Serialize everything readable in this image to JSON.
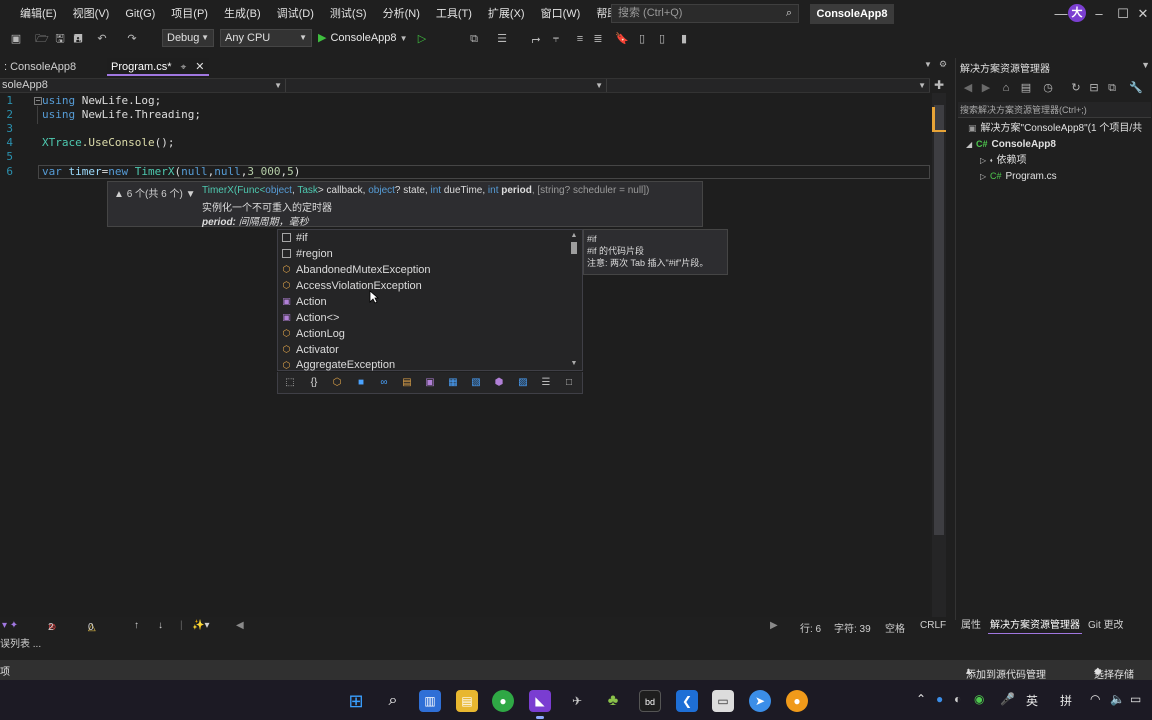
{
  "menu": {
    "items": [
      "编辑(E)",
      "视图(V)",
      "Git(G)",
      "项目(P)",
      "生成(B)",
      "调试(D)",
      "测试(S)",
      "分析(N)",
      "工具(T)",
      "扩展(X)",
      "窗口(W)",
      "帮助(H)"
    ],
    "search_placeholder": "搜索 (Ctrl+Q)",
    "solution_name": "ConsoleApp8",
    "user_initial": "大"
  },
  "toolbar": {
    "config": "Debug",
    "platform": "Any CPU",
    "run_target": "ConsoleApp8"
  },
  "tabs": [
    {
      "label": ": ConsoleApp8"
    },
    {
      "label": "Program.cs*"
    }
  ],
  "navbar": {
    "project": "soleApp8"
  },
  "editor": {
    "line_numbers": [
      "1",
      "2",
      "3",
      "4",
      "5",
      "6"
    ],
    "lines": {
      "l1_kw": "using",
      "l1_ns": " NewLife.Log;",
      "l2_kw": "using",
      "l2_ns": " NewLife.Threading;",
      "l4_type": "XTrace",
      "l4_method": ".UseConsole",
      "l4_rest": "();",
      "l6_var": "var",
      "l6_name": " timer",
      "l6_eq": "=",
      "l6_new": "new",
      "l6_type": " TimerX",
      "l6_args_a": "(",
      "l6_null1": "null",
      "l6_comma1": ",",
      "l6_null2": "null",
      "l6_comma2": ",",
      "l6_num1": "3_000",
      "l6_comma3": ",",
      "l6_num2": "5",
      "l6_close": ")"
    }
  },
  "signature_help": {
    "counter": "6 个(共 6 个)",
    "sig_type": "TimerX",
    "sig_open": "(Func<",
    "sig_object": "object",
    "sig_comma": ", ",
    "sig_task": "Task",
    "sig_close": "> callback, ",
    "sig_object2": "object",
    "sig_state": "? state, ",
    "sig_int": "int",
    "sig_due": " dueTime, ",
    "sig_int2": "int",
    "sig_period": " period",
    "sig_opt": ", [string? scheduler = null])",
    "description": "实例化一个不可重入的定时器",
    "param_name": "period:",
    "param_desc": " 间隔周期，毫秒"
  },
  "completion": {
    "items": [
      {
        "label": "#if",
        "icon": "snippet-icon"
      },
      {
        "label": "#region",
        "icon": "snippet-icon"
      },
      {
        "label": "AbandonedMutexException",
        "icon": "class-icon"
      },
      {
        "label": "AccessViolationException",
        "icon": "class-icon"
      },
      {
        "label": "Action",
        "icon": "delegate-icon"
      },
      {
        "label": "Action<>",
        "icon": "delegate-icon"
      },
      {
        "label": "ActionLog",
        "icon": "class-icon"
      },
      {
        "label": "Activator",
        "icon": "class-icon"
      },
      {
        "label": "AggregateException",
        "icon": "class-icon"
      }
    ],
    "tooltip": {
      "title": "#if",
      "desc": "#if 的代码片段",
      "note": "注意: 两次 Tab 插入\"#if\"片段。"
    }
  },
  "solution_explorer": {
    "title": "解决方案资源管理器",
    "search_placeholder": "搜索解决方案资源管理器(Ctrl+;)",
    "solution_row": "解决方案\"ConsoleApp8\"(1 个项目/共",
    "project_row": "ConsoleApp8",
    "deps_row": "依赖项",
    "file_row": "Program.cs"
  },
  "bottom_tabs": [
    "属性",
    "解决方案资源管理器",
    "Git 更改"
  ],
  "editor_status": {
    "errors": "2",
    "warnings": "0",
    "line": "行: 6",
    "col": "字符: 39",
    "spaces": "空格",
    "eol": "CRLF"
  },
  "error_list_label": "误列表 ...",
  "statusbar": {
    "left": "项",
    "source_control": "添加到源代码管理",
    "repo": "选择存储"
  },
  "taskbar": {
    "ime_lang": "英",
    "ime_mode": "拼"
  },
  "colors": {
    "accent": "#a077e0",
    "keyword": "#569cd6",
    "type": "#4ec9b0",
    "number": "#b5cea8"
  }
}
